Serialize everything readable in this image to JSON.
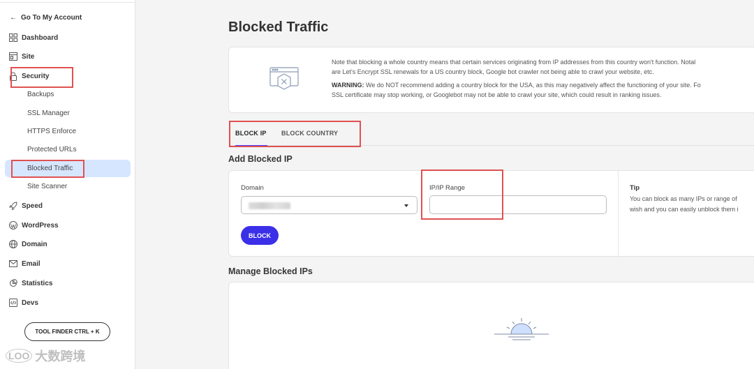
{
  "sidebar": {
    "back_link": "Go To My Account",
    "back_arrow": "←",
    "items": [
      {
        "label": "Dashboard",
        "icon": "grid-icon"
      },
      {
        "label": "Site",
        "icon": "site-icon"
      },
      {
        "label": "Security",
        "icon": "lock-icon"
      },
      {
        "label": "Speed",
        "icon": "rocket-icon"
      },
      {
        "label": "WordPress",
        "icon": "wordpress-icon"
      },
      {
        "label": "Domain",
        "icon": "globe-icon"
      },
      {
        "label": "Email",
        "icon": "envelope-icon"
      },
      {
        "label": "Statistics",
        "icon": "pie-chart-icon"
      },
      {
        "label": "Devs",
        "icon": "code-icon"
      }
    ],
    "security_sub": [
      "Backups",
      "SSL Manager",
      "HTTPS Enforce",
      "Protected URLs",
      "Blocked Traffic",
      "Site Scanner"
    ],
    "active_sub": "Blocked Traffic",
    "tool_finder": "TOOL FINDER CTRL + K"
  },
  "watermark": {
    "logo": "LOO",
    "text": "大数跨境"
  },
  "main": {
    "title": "Blocked Traffic",
    "notice": {
      "line1": "Note that blocking a whole country means that certain services originating from IP addresses from this country won't function. Notal",
      "line2": "are Let's Encrypt SSL renewals for a US country block, Google bot crawler not being able to crawl your website, etc.",
      "warning_label": "WARNING:",
      "line3": " We do NOT recommend adding a country block for the USA, as this may negatively affect the functioning of your site. Fo",
      "line4": "SSL certificate may stop working, or Googlebot may not be able to crawl your site, which could result in ranking issues."
    },
    "tabs": [
      {
        "label": "BLOCK IP",
        "active": true
      },
      {
        "label": "BLOCK COUNTRY",
        "active": false
      }
    ],
    "add_section_title": "Add Blocked IP",
    "form": {
      "domain_label": "Domain",
      "domain_value": "",
      "ip_label": "IP/IP Range",
      "ip_value": "",
      "ip_placeholder": "",
      "block_button": "BLOCK"
    },
    "tip": {
      "title": "Tip",
      "line1": "You can block as many IPs or range of",
      "line2": "wish and you can easily unblock them i"
    },
    "manage_section_title": "Manage Blocked IPs"
  },
  "colors": {
    "accent": "#3b2fe8",
    "highlight": "#e05050",
    "active_bg": "#d7e6ff"
  }
}
